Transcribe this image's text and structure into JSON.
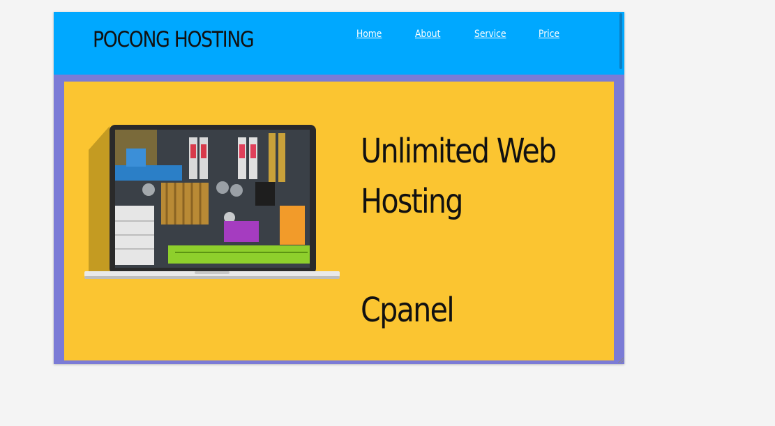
{
  "header": {
    "brand": "POCONG HOSTING",
    "nav": [
      {
        "label": "Home"
      },
      {
        "label": "About"
      },
      {
        "label": "Service"
      },
      {
        "label": "Price"
      }
    ]
  },
  "hero": {
    "headline": "Unlimited Web Hosting",
    "subheadline": "Cpanel",
    "image_icon": "laptop-motherboard-image"
  },
  "colors": {
    "page_background": "#f4f4f4",
    "header_background": "#00a8ff",
    "frame_border": "#7b7bd6",
    "hero_background": "#fbc531",
    "nav_text": "#ffffff",
    "heading_text": "#111111"
  }
}
